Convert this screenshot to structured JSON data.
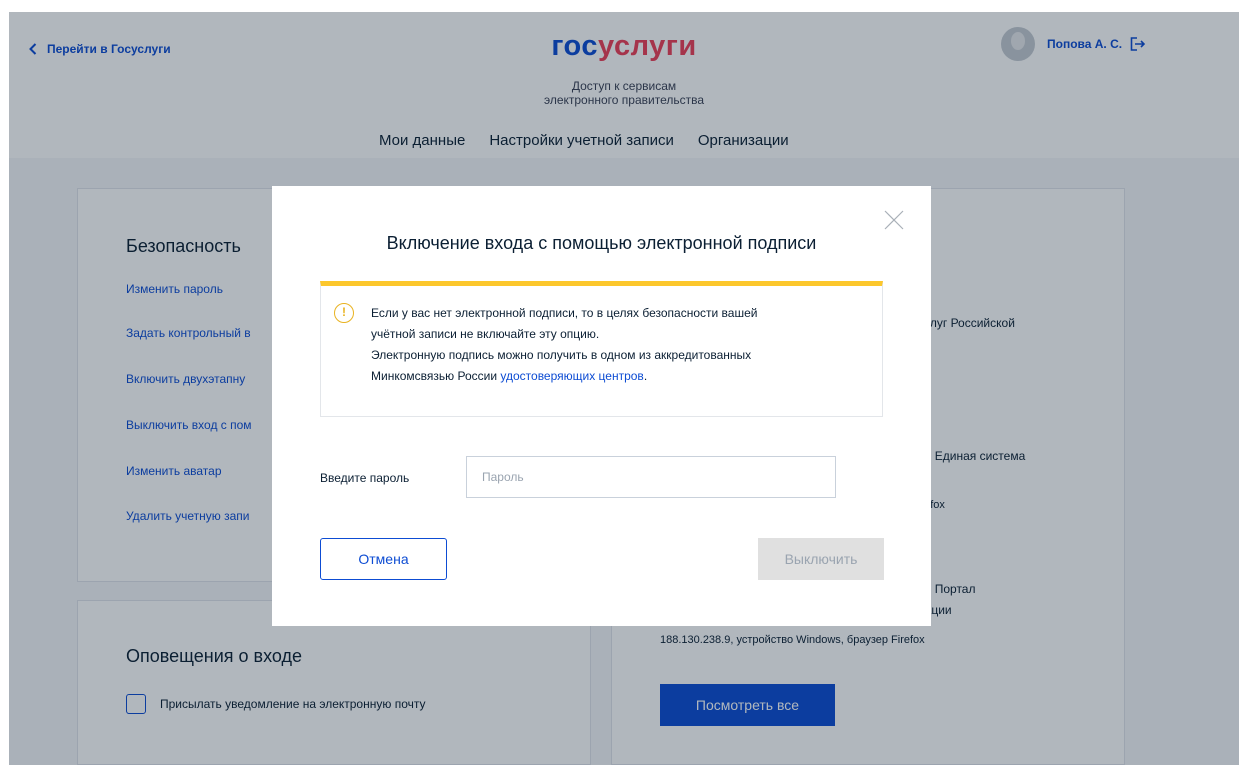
{
  "header": {
    "back_label": "Перейти в Госуслуги",
    "logo_part1": "гос",
    "logo_part2": "услуги",
    "subtitle_line1": "Доступ к сервисам",
    "subtitle_line2": "электронного правительства",
    "user_name": "Попова А. С."
  },
  "tabs": [
    {
      "label": "Мои данные",
      "active": false
    },
    {
      "label": "Настройки учетной записи",
      "active": true
    },
    {
      "label": "Организации",
      "active": false
    }
  ],
  "security": {
    "title": "Безопасность",
    "links": [
      "Изменить пароль",
      "Задать контрольный в",
      "Включить двухэтапну",
      "Выключить вход с пом",
      "Изменить аватар",
      "Удалить учетную запи"
    ]
  },
  "notifications": {
    "title": "Оповещения о входе",
    "checkbox_label": "Присылать уведомление на электронную почту"
  },
  "activity": {
    "line1": "услуг Российской",
    "line2": "ии Единая система",
    "line3": "irefox",
    "line4a": "ии Портал",
    "line4b": "рации",
    "line5": "188.130.238.9, устройство Windows, браузер Firefox",
    "view_all": "Посмотреть все"
  },
  "modal": {
    "title": "Включение входа с помощью электронной подписи",
    "warn_line1": "Если у вас нет электронной подписи, то в целях безопасности вашей",
    "warn_line2": "учётной записи не включайте эту опцию.",
    "warn_line3": "Электронную подпись можно получить в одном из аккредитованных",
    "warn_line4": "Минкомсвязью России",
    "warn_link": "удостоверяющих центров",
    "warn_dot": ".",
    "warn_icon": "!",
    "password_label": "Введите пароль",
    "password_placeholder": "Пароль",
    "password_value": "",
    "cancel_label": "Отмена",
    "submit_label": "Выключить"
  },
  "colors": {
    "accent": "#0d4cd3",
    "brand_red": "#ee3f58",
    "warning": "#fcc72c"
  }
}
